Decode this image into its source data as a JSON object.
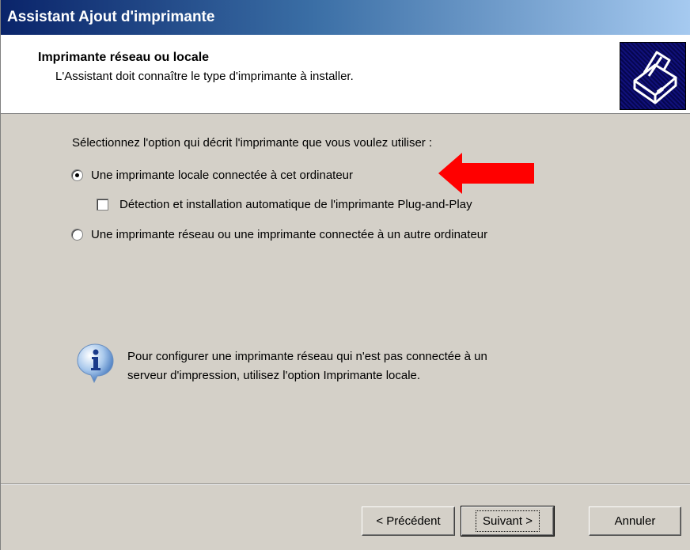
{
  "window": {
    "title": "Assistant Ajout d'imprimante"
  },
  "header": {
    "title": "Imprimante réseau ou locale",
    "subtitle": "L'Assistant doit connaître le type d'imprimante à installer.",
    "icon": "printer-icon"
  },
  "body": {
    "prompt": "Sélectionnez l'option qui décrit l'imprimante que vous voulez utiliser :",
    "options": [
      {
        "label": "Une imprimante locale connectée à cet ordinateur",
        "selected": true
      },
      {
        "label": "Une imprimante réseau ou une imprimante connectée à un autre ordinateur",
        "selected": false
      }
    ],
    "plug_and_play": {
      "label": "Détection et installation automatique de l'imprimante Plug-and-Play",
      "checked": false
    },
    "annotation_arrow": {
      "color": "#ff0000",
      "icon": "red-arrow-icon"
    },
    "info": {
      "icon": "info-icon",
      "line1": "Pour configurer une imprimante réseau qui n'est pas connectée à un",
      "line2": "serveur d'impression, utilisez l'option Imprimante locale."
    }
  },
  "footer": {
    "back_label": "< Précédent",
    "next_label": "Suivant >",
    "cancel_label": "Annuler"
  }
}
